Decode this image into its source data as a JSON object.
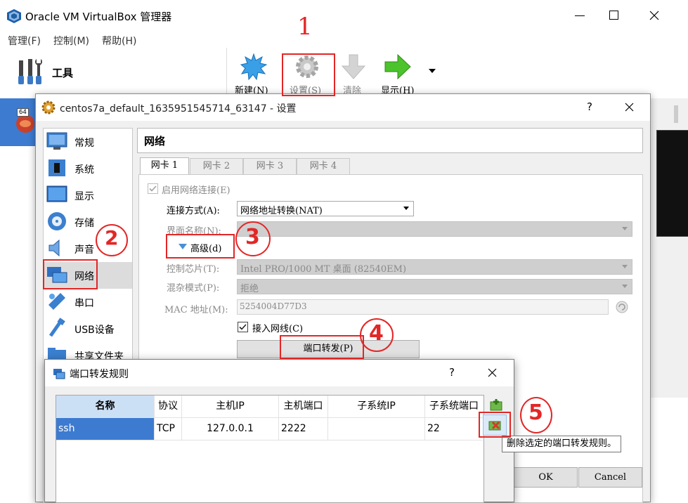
{
  "main_window": {
    "title": "Oracle VM VirtualBox 管理器",
    "menu": [
      "管理(F)",
      "控制(M)",
      "帮助(H)"
    ],
    "tools_label": "工具",
    "toolbar": [
      {
        "label": "新建(N)",
        "icon": "new-icon"
      },
      {
        "label": "设置(S)",
        "icon": "settings-gear-icon"
      },
      {
        "label": "清除",
        "icon": "discard-arrow-icon"
      },
      {
        "label": "显示(H)",
        "icon": "show-arrow-icon"
      }
    ],
    "vm_badge": "64"
  },
  "settings": {
    "title": "centos7a_default_1635951545714_63147 - 设置",
    "help": "?",
    "sidebar": [
      "常规",
      "系统",
      "显示",
      "存储",
      "声音",
      "网络",
      "串口",
      "USB设备",
      "共享文件夹"
    ],
    "page_title": "网络",
    "tabs": [
      "网卡 1",
      "网卡 2",
      "网卡 3",
      "网卡 4"
    ],
    "enable_label": "启用网络连接(E)",
    "attach_label": "连接方式(A):",
    "attach_value": "网络地址转换(NAT)",
    "name_label": "界面名称(N):",
    "advanced_label": "高级(d)",
    "adapter_label": "控制芯片(T):",
    "adapter_value": "Intel PRO/1000 MT 桌面 (82540EM)",
    "promisc_label": "混杂模式(P):",
    "promisc_value": "拒绝",
    "mac_label": "MAC 地址(M):",
    "mac_value": "5254004D77D3",
    "cable_label": "接入网线(C)",
    "port_forward_button": "端口转发(P)",
    "ok": "OK",
    "cancel": "Cancel"
  },
  "port_forward_dialog": {
    "title": "端口转发规则",
    "help": "?",
    "columns": [
      "名称",
      "协议",
      "主机IP",
      "主机端口",
      "子系统IP",
      "子系统端口"
    ],
    "rows": [
      {
        "name": "ssh",
        "protocol": "TCP",
        "host_ip": "127.0.0.1",
        "host_port": "2222",
        "guest_ip": "",
        "guest_port": "22"
      }
    ],
    "tooltip": "删除选定的端口转发规则。"
  },
  "annotations": [
    "1",
    "2",
    "3",
    "4",
    "5"
  ],
  "colors": {
    "annotation": "#e32626",
    "selection": "#3d7bd1",
    "nav_active": "#dcdcdc"
  }
}
